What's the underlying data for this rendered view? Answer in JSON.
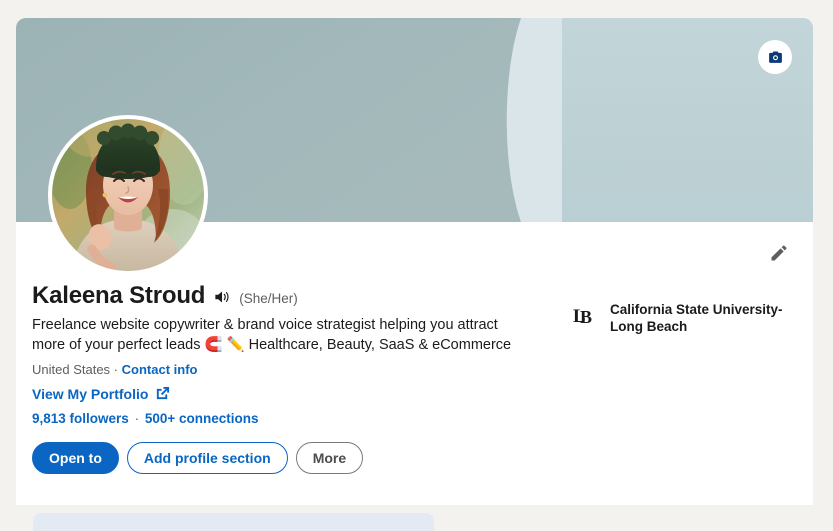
{
  "page": {
    "background_color": "#f4f2ee"
  },
  "banner": {
    "colors": {
      "sage": "#9db5b8",
      "pale": "#d8e4e8",
      "blue_gray": "#bdd2d6"
    },
    "camera_button": {
      "icon": "camera-icon",
      "icon_color": "#0b3a77",
      "background": "#ffffff"
    }
  },
  "avatar": {
    "icon": "profile-photo",
    "alt": "Kaleena Stroud profile photo"
  },
  "edit": {
    "icon": "pencil-icon",
    "color": "#5e5e5e"
  },
  "profile": {
    "name": "Kaleena Stroud",
    "audio_icon": "speaker-icon",
    "pronouns": "(She/Her)",
    "headline": "Freelance website copywriter & brand voice strategist helping you attract more of your perfect leads 🧲 ✏️ Healthcare, Beauty, SaaS & eCommerce",
    "location": "United States",
    "location_separator": "·",
    "contact_info_label": "Contact info",
    "portfolio_label": "View My Portfolio",
    "portfolio_icon": "external-link-icon",
    "followers": "9,813 followers",
    "connections_separator": "·",
    "connections": "500+ connections",
    "accent_color": "#0a66c2"
  },
  "actions": {
    "open_to_label": "Open to",
    "add_profile_section_label": "Add profile section",
    "more_label": "More"
  },
  "education": {
    "logo_icon": "csulb-lb-monogram-logo",
    "school_name": "California State University-Long Beach"
  }
}
